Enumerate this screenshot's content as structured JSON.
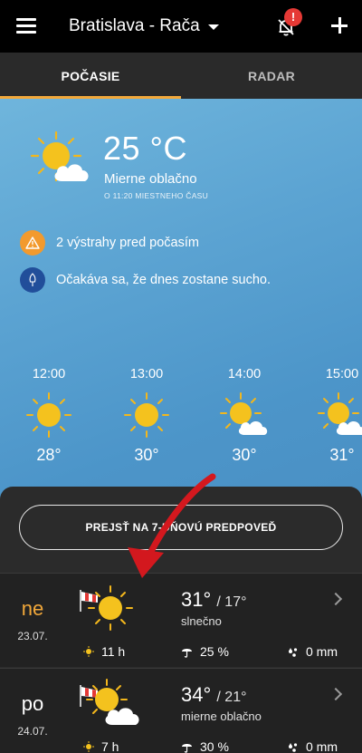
{
  "header": {
    "location": "Bratislava - Rača",
    "notification_badge": "!"
  },
  "tabs": [
    {
      "label": "POČASIE",
      "active": true
    },
    {
      "label": "RADAR",
      "active": false
    }
  ],
  "current": {
    "temperature": "25 °C",
    "description": "Mierne oblačno",
    "time_note": "O 11:20 MIESTNEHO ČASU",
    "icon": "sun-cloud-icon"
  },
  "alerts": [
    {
      "text": "2 výstrahy pred počasím",
      "icon": "warning-icon",
      "color": "#f29a2e"
    },
    {
      "text": "Očakáva sa, že dnes zostane sucho.",
      "icon": "dry-umbrella-icon",
      "color": "#214e9a"
    }
  ],
  "hourly": [
    {
      "time": "12:00",
      "temp": "28°",
      "icon": "sun-icon"
    },
    {
      "time": "13:00",
      "temp": "30°",
      "icon": "sun-icon"
    },
    {
      "time": "14:00",
      "temp": "30°",
      "icon": "sun-cloud-icon"
    },
    {
      "time": "15:00",
      "temp": "31°",
      "icon": "sun-cloud-icon"
    }
  ],
  "forecast_button": "PREJSŤ NA 7-DŇOVÚ PREDPOVEĎ",
  "days": [
    {
      "name": "ne",
      "date": "23.07.",
      "max": "31°",
      "min": "/ 17°",
      "description": "slnečno",
      "sun": "11 h",
      "rain_chance": "25 %",
      "precip": "0 mm",
      "icon": "sun-icon",
      "name_color": "#f2a83a"
    },
    {
      "name": "po",
      "date": "24.07.",
      "max": "34°",
      "min": "/ 21°",
      "description": "mierne oblačno",
      "sun": "7 h",
      "rain_chance": "30 %",
      "precip": "0 mm",
      "icon": "sun-cloud-icon",
      "name_color": "#ffffff"
    }
  ],
  "colors": {
    "accent": "#f2a83a",
    "sky_top": "#6fb5dc",
    "sky_bottom": "#4a90c4",
    "annotation_arrow": "#d3181e"
  }
}
